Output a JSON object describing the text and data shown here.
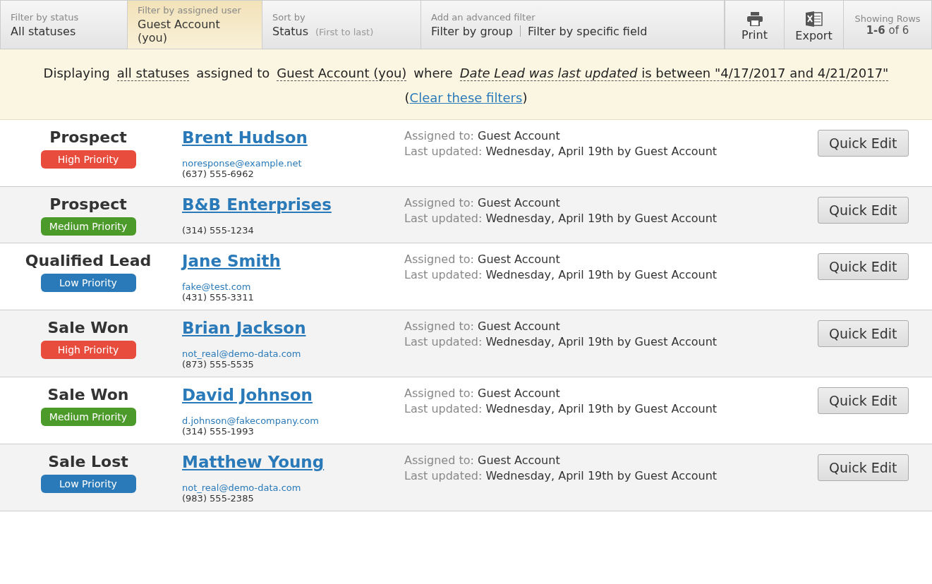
{
  "toolbar": {
    "filters": [
      {
        "label": "Filter by status",
        "value": "All statuses",
        "selected": false
      },
      {
        "label": "Filter by assigned user",
        "value": "Guest Account (you)",
        "selected": true
      },
      {
        "label": "Sort by",
        "value": "Status",
        "note": "(First to last)",
        "selected": false
      }
    ],
    "advanced": {
      "label": "Add an advanced filter",
      "links": [
        "Filter by group",
        "Filter by specific field"
      ]
    },
    "actions": [
      {
        "kind": "print",
        "label": "Print"
      },
      {
        "kind": "export",
        "label": "Export"
      }
    ],
    "rows_info": {
      "label": "Showing Rows",
      "range": "1-6",
      "total": "of 6"
    }
  },
  "banner": [
    {
      "kind": "text",
      "text": "Displaying"
    },
    {
      "kind": "token",
      "text": "all statuses"
    },
    {
      "kind": "text",
      "text": "assigned to"
    },
    {
      "kind": "token",
      "text": "Guest Account (you)"
    },
    {
      "kind": "text",
      "text": "where"
    },
    {
      "kind": "field",
      "text": "Date Lead was last updated",
      "rest": "is between \"4/17/2017 and 4/21/2017\""
    },
    {
      "kind": "link",
      "before": "(",
      "text": "Clear these filters",
      "after": ")"
    }
  ],
  "leads": [
    {
      "status": "Prospect",
      "priority": "High Priority",
      "color": "#e74c3c",
      "name": "Brent Hudson",
      "email": "noresponse@example.net",
      "phone": "(637) 555-6962",
      "assigned_label": "Assigned to:",
      "assigned": "Guest Account",
      "updated_label": "Last updated:",
      "updated": "Wednesday, April 19th by Guest Account",
      "action": "Quick Edit"
    },
    {
      "status": "Prospect",
      "priority": "Medium Priority",
      "color": "#4c9a2a",
      "name": "B&B Enterprises",
      "phone": "(314) 555-1234",
      "assigned_label": "Assigned to:",
      "assigned": "Guest Account",
      "updated_label": "Last updated:",
      "updated": "Wednesday, April 19th by Guest Account",
      "action": "Quick Edit"
    },
    {
      "status": "Qualified Lead",
      "priority": "Low Priority",
      "color": "#2a7ab9",
      "name": "Jane Smith",
      "email": "fake@test.com",
      "phone": "(431) 555-3311",
      "assigned_label": "Assigned to:",
      "assigned": "Guest Account",
      "updated_label": "Last updated:",
      "updated": "Wednesday, April 19th by Guest Account",
      "action": "Quick Edit"
    },
    {
      "status": "Sale Won",
      "priority": "High Priority",
      "color": "#e74c3c",
      "name": "Brian Jackson",
      "email": "not_real@demo-data.com",
      "phone": "(873) 555-5535",
      "assigned_label": "Assigned to:",
      "assigned": "Guest Account",
      "updated_label": "Last updated:",
      "updated": "Wednesday, April 19th by Guest Account",
      "action": "Quick Edit"
    },
    {
      "status": "Sale Won",
      "priority": "Medium Priority",
      "color": "#4c9a2a",
      "name": "David Johnson",
      "email": "d.johnson@fakecompany.com",
      "phone": "(314) 555-1993",
      "assigned_label": "Assigned to:",
      "assigned": "Guest Account",
      "updated_label": "Last updated:",
      "updated": "Wednesday, April 19th by Guest Account",
      "action": "Quick Edit"
    },
    {
      "status": "Sale Lost",
      "priority": "Low Priority",
      "color": "#2a7ab9",
      "name": "Matthew Young",
      "email": "not_real@demo-data.com",
      "phone": "(983) 555-2385",
      "assigned_label": "Assigned to:",
      "assigned": "Guest Account",
      "updated_label": "Last updated:",
      "updated": "Wednesday, April 19th by Guest Account",
      "action": "Quick Edit"
    }
  ]
}
